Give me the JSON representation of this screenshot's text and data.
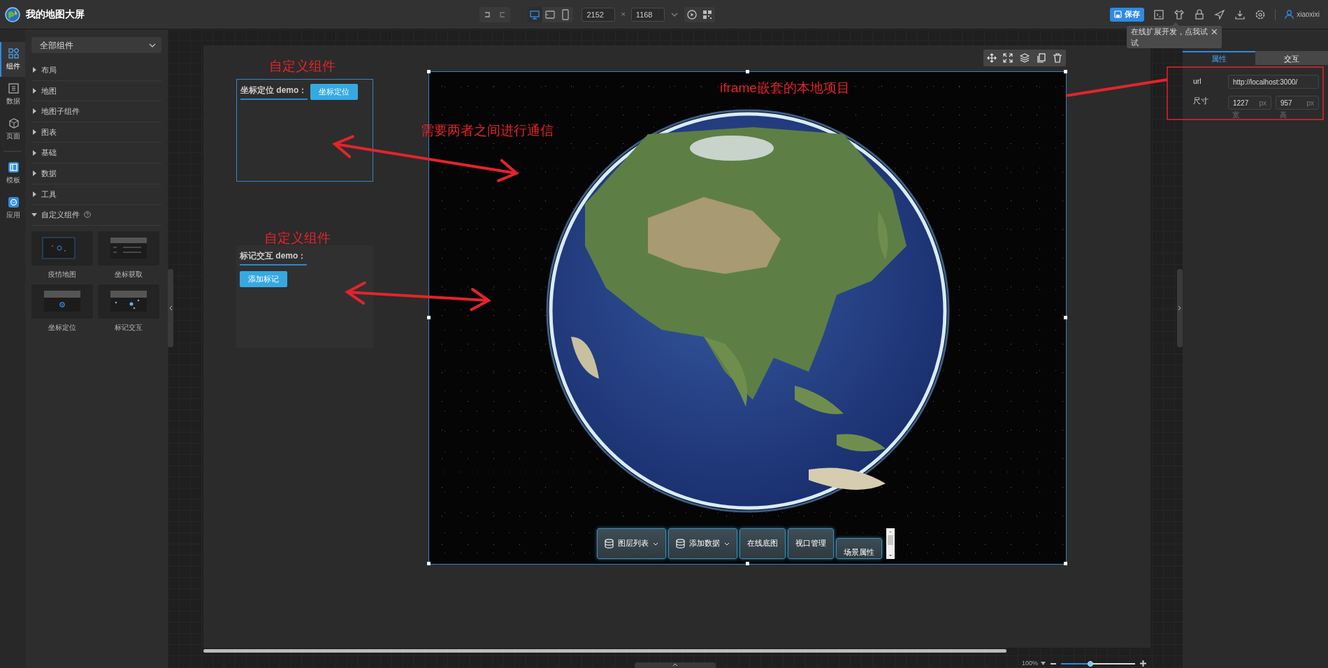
{
  "header": {
    "title": "我的地图大屏",
    "width_field": "2152",
    "separator": "×",
    "height_field": "1168",
    "save_button": "保存",
    "user": "xiaoxixi",
    "devices": [
      {
        "kind": "desktop",
        "selected": true
      },
      {
        "kind": "tablet",
        "selected": false
      },
      {
        "kind": "phone",
        "selected": false
      }
    ]
  },
  "tooltip": {
    "text": "在线扩展开发，点我试试"
  },
  "rail": [
    {
      "label": "组件",
      "selected": true
    },
    {
      "label": "数据",
      "selected": false
    },
    {
      "label": "页面",
      "selected": false
    },
    {
      "label": "模板",
      "selected": false
    },
    {
      "label": "应用",
      "selected": false
    }
  ],
  "sidebar": {
    "dropdown": "全部组件",
    "categories": [
      {
        "label": "布局",
        "expanded": false
      },
      {
        "label": "地图",
        "expanded": false
      },
      {
        "label": "地图子组件",
        "expanded": false
      },
      {
        "label": "图表",
        "expanded": false
      },
      {
        "label": "基础",
        "expanded": false
      },
      {
        "label": "数据",
        "expanded": false
      },
      {
        "label": "工具",
        "expanded": false
      },
      {
        "label": "自定义组件",
        "expanded": true,
        "children": [
          {
            "label": "疫情地图"
          },
          {
            "label": "坐标获取"
          },
          {
            "label": "坐标定位"
          },
          {
            "label": "标记交互"
          }
        ]
      }
    ]
  },
  "canvas": {
    "annotations": [
      {
        "text": "自定义组件"
      },
      {
        "text": "自定义组件"
      },
      {
        "text": "iframe嵌套的本地项目"
      },
      {
        "text": "需要两者之间进行通信"
      }
    ],
    "widgets": [
      {
        "title": "坐标定位 demo：",
        "button": "坐标定位",
        "highlighted": true
      },
      {
        "title": "标记交互 demo：",
        "button": "添加标记",
        "highlighted": false
      }
    ],
    "map": {
      "selected": true,
      "toolbar": [
        {
          "label": "图层列表",
          "kind": "dropdown"
        },
        {
          "label": "添加数据",
          "kind": "dropdown"
        },
        {
          "label": "在线底图",
          "kind": "plain"
        },
        {
          "label": "视口管理",
          "kind": "plain"
        },
        {
          "label": "场景属性",
          "kind": "lowered"
        }
      ]
    }
  },
  "right_panel": {
    "tabs": [
      {
        "label": "属性",
        "selected": true
      },
      {
        "label": "交互",
        "selected": false
      }
    ],
    "url": {
      "label": "url",
      "value": "http://localhost:3000/"
    },
    "size": {
      "label": "尺寸",
      "inputs": [
        {
          "value": "1227",
          "unit": "px",
          "caption": "宽"
        },
        {
          "value": "957",
          "unit": "px",
          "caption": "高"
        }
      ]
    }
  },
  "footer": {
    "zoom": "100%",
    "level": 0.4
  }
}
